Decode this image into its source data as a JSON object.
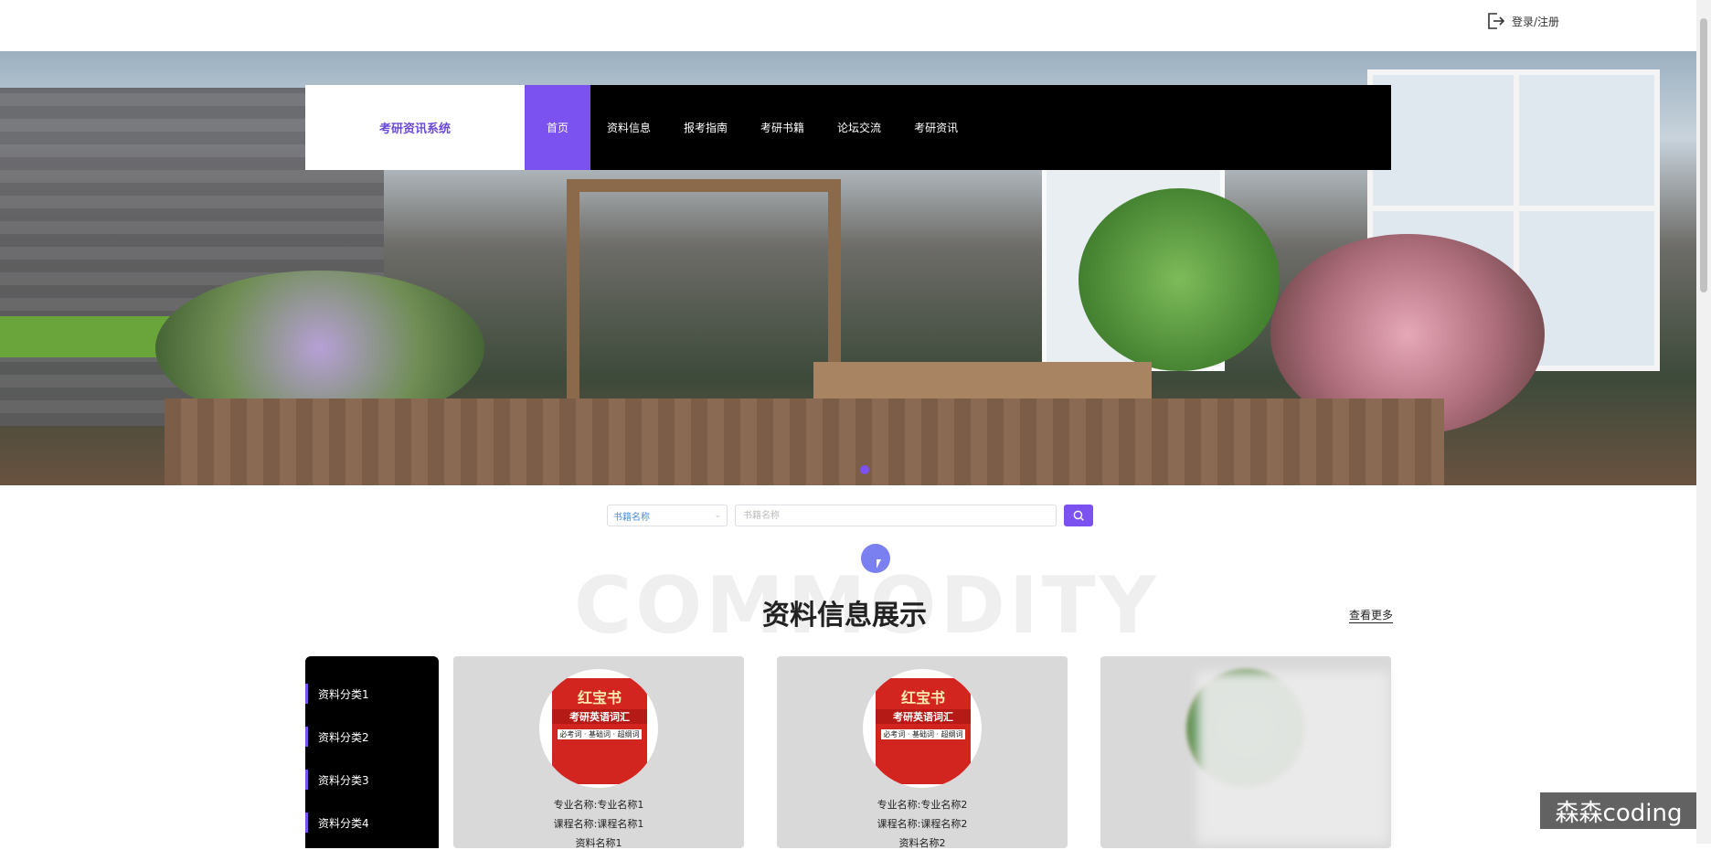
{
  "header": {
    "login_label": "登录/注册"
  },
  "nav": {
    "brand": "考研资讯系统",
    "items": [
      "首页",
      "资料信息",
      "报考指南",
      "考研书籍",
      "论坛交流",
      "考研资讯"
    ]
  },
  "search": {
    "select_value": "书籍名称",
    "input_placeholder": "书籍名称"
  },
  "section": {
    "bg_text": "COMMODITY",
    "title": "资料信息展示",
    "more_label": "查看更多"
  },
  "categories": [
    "资料分类1",
    "资料分类2",
    "资料分类3",
    "资料分类4"
  ],
  "cards": [
    {
      "book_title": "红宝书",
      "book_subtitle": "考研英语词汇",
      "book_tag": "必考词 · 基础词 · 超纲词",
      "major": "专业名称:专业名称1",
      "course": "课程名称:课程名称1",
      "material": "资料名称1"
    },
    {
      "book_title": "红宝书",
      "book_subtitle": "考研英语词汇",
      "book_tag": "必考词 · 基础词 · 超纲词",
      "major": "专业名称:专业名称2",
      "course": "课程名称:课程名称2",
      "material": "资料名称2"
    }
  ],
  "watermark": "森森coding",
  "colors": {
    "accent": "#7b52f0",
    "nav_bg": "#000000",
    "card_bg": "#d9d9d9"
  }
}
